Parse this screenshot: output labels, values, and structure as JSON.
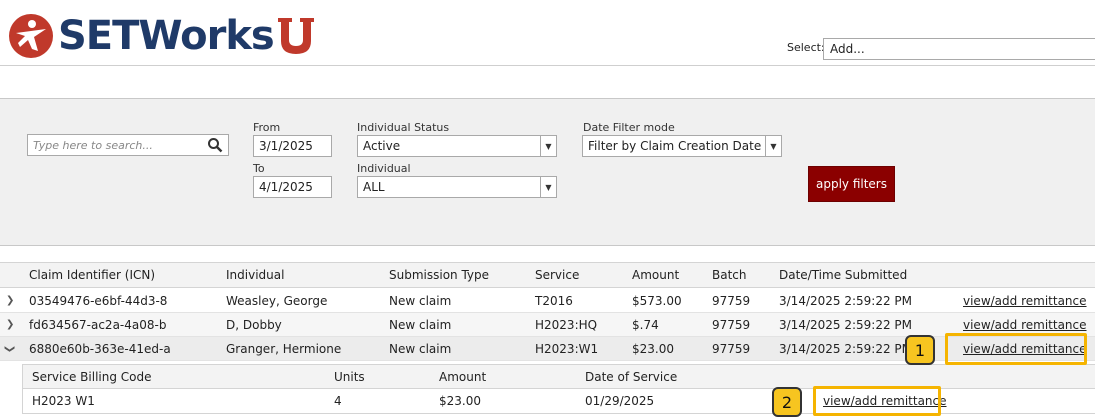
{
  "header": {
    "logo_text": "SETWorks",
    "select_label": "Select:",
    "select_value": "Add..."
  },
  "filters": {
    "search_placeholder": "Type here to search...",
    "from_label": "From",
    "from_value": "3/1/2025",
    "to_label": "To",
    "to_value": "4/1/2025",
    "status_label": "Individual Status",
    "status_value": "Active",
    "individual_label": "Individual",
    "individual_value": "ALL",
    "date_mode_label": "Date Filter mode",
    "date_mode_value": "Filter by Claim Creation Date",
    "apply_label": "apply filters"
  },
  "table": {
    "headers": [
      "Claim Identifier (ICN)",
      "Individual",
      "Submission Type",
      "Service",
      "Amount",
      "Batch",
      "Date/Time Submitted"
    ],
    "rows": [
      {
        "icn": "03549476-e6bf-44d3-8",
        "individual": "Weasley, George",
        "type": "New claim",
        "service": "T2016",
        "amount": "$573.00",
        "batch": "97759",
        "date": "3/14/2025 2:59:22 PM",
        "link": "view/add remittance"
      },
      {
        "icn": "fd634567-ac2a-4a08-b",
        "individual": "D, Dobby",
        "type": "New claim",
        "service": "H2023:HQ",
        "amount": "$.74",
        "batch": "97759",
        "date": "3/14/2025 2:59:22 PM",
        "link": "view/add remittance"
      },
      {
        "icn": "6880e60b-363e-41ed-a",
        "individual": "Granger, Hermione",
        "type": "New claim",
        "service": "H2023:W1",
        "amount": "$23.00",
        "batch": "97759",
        "date": "3/14/2025 2:59:22 PM",
        "link": "view/add remittance"
      }
    ]
  },
  "sub_table": {
    "headers": [
      "Service Billing Code",
      "Units",
      "Amount",
      "Date of Service"
    ],
    "row": {
      "code": "H2023 W1",
      "units": "4",
      "amount": "$23.00",
      "date": "01/29/2025",
      "link": "view/add remittance"
    }
  },
  "callouts": {
    "one": "1",
    "two": "2"
  },
  "colors": {
    "brand_blue": "#1f3a68",
    "brand_red": "#c0392b",
    "apply_button": "#8b0000",
    "callout": "#f5b400"
  }
}
